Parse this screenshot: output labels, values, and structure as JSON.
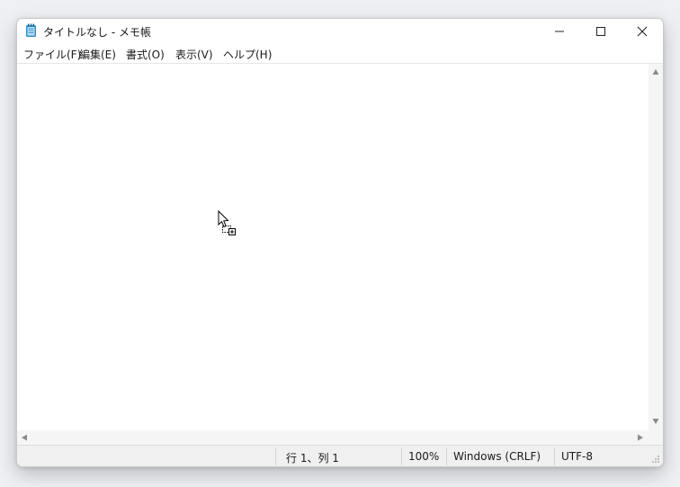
{
  "window": {
    "title": "タイトルなし - メモ帳",
    "icon": "notepad-icon"
  },
  "caption_buttons": {
    "minimize": "minimize-icon",
    "maximize": "maximize-icon",
    "close": "close-icon"
  },
  "menu": {
    "items": [
      {
        "label": "ファイル(F)"
      },
      {
        "label": "編集(E)"
      },
      {
        "label": "書式(O)"
      },
      {
        "label": "表示(V)"
      },
      {
        "label": "ヘルプ(H)"
      }
    ]
  },
  "editor": {
    "content": ""
  },
  "status": {
    "position": "行 1、列 1",
    "zoom": "100%",
    "line_ending": "Windows (CRLF)",
    "encoding": "UTF-8"
  },
  "colors": {
    "accent_icon": "#2b8fd6",
    "background": "#eef0f4"
  }
}
